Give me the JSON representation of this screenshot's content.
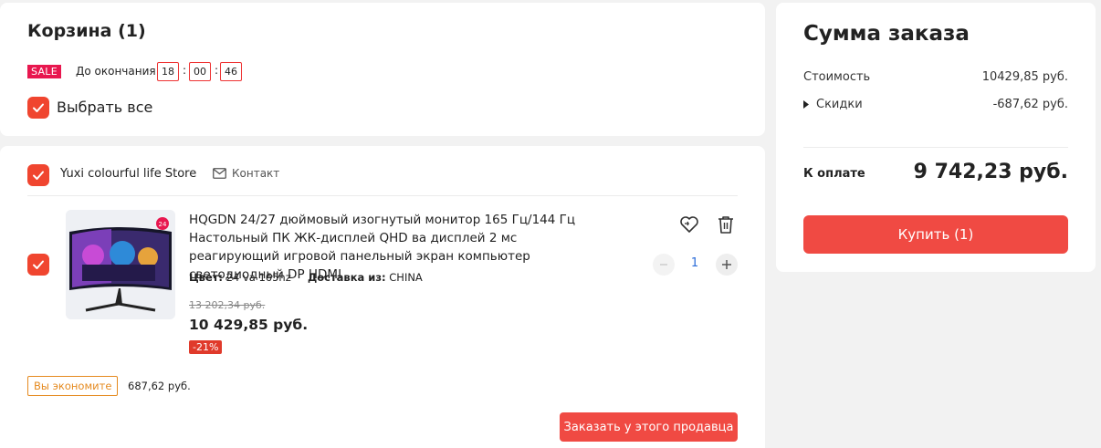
{
  "cart": {
    "title": "Корзина (1)",
    "sale_badge": "SALE",
    "timer_label": "До окончания:",
    "timer": {
      "hours": "18",
      "minutes": "00",
      "seconds": "46",
      "sep": ":"
    },
    "select_all_label": "Выбрать все"
  },
  "store": {
    "name": "Yuxi colourful life Store",
    "contact_label": "Контакт"
  },
  "product": {
    "title": "HQGDN 24/27 дюймовый изогнутый монитор 165 Гц/144 Гц Настольный ПК ЖК-дисплей QHD ва дисплей 2 мс реагирующий игровой панельный экран компьютер светодиодный DP HDMI",
    "color_label": "Цвет:",
    "color_value": "24 va 165hz",
    "shipping_label": "Доставка из:",
    "shipping_value": "CHINA",
    "old_price": "13 202,34 руб.",
    "new_price": "10 429,85 руб.",
    "discount": "-21%",
    "quantity": "1",
    "image_badge": "24"
  },
  "savings": {
    "label": "Вы экономите",
    "amount": "687,62 руб."
  },
  "seller_order_button": "Заказать у этого продавца",
  "summary": {
    "title": "Сумма заказа",
    "cost_label": "Стоимость",
    "cost_value": "10429,85 руб.",
    "discount_label": "Скидки",
    "discount_value": "-687,62 руб.",
    "pay_label": "К оплате",
    "pay_total": "9 742,23 руб.",
    "buy_button": "Купить (1)"
  },
  "colors": {
    "accent": "#f04a43",
    "sale": "#e8174f",
    "saving": "#e58a1f",
    "quantity": "#2b6cd8"
  }
}
